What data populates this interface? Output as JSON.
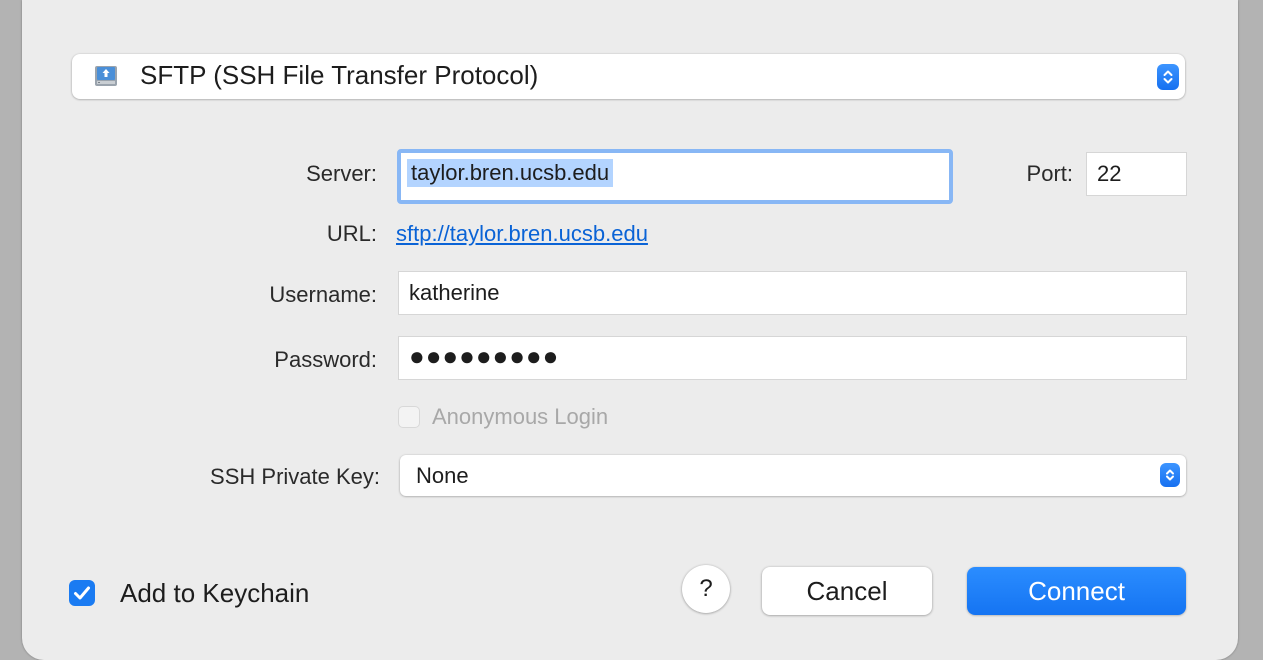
{
  "protocol": {
    "selected": "SFTP (SSH File Transfer Protocol)",
    "icon": "network-drive-icon"
  },
  "server": {
    "label": "Server:",
    "value": "taylor.bren.ucsb.edu"
  },
  "port": {
    "label": "Port:",
    "value": "22"
  },
  "url": {
    "label": "URL:",
    "value": "sftp://taylor.bren.ucsb.edu"
  },
  "username": {
    "label": "Username:",
    "value": "katherine"
  },
  "password": {
    "label": "Password:",
    "masked_value": "●●●●●●●●●"
  },
  "anonymous_login": {
    "label": "Anonymous Login",
    "checked": false,
    "enabled": false
  },
  "ssh_private_key": {
    "label": "SSH Private Key:",
    "selected": "None"
  },
  "add_to_keychain": {
    "label": "Add to Keychain",
    "checked": true
  },
  "buttons": {
    "help": "?",
    "cancel": "Cancel",
    "connect": "Connect"
  },
  "colors": {
    "accent": "#1a7bf2",
    "link": "#0a63d6",
    "focus_ring": "#88b7f5",
    "selection": "#b3d4ff"
  }
}
